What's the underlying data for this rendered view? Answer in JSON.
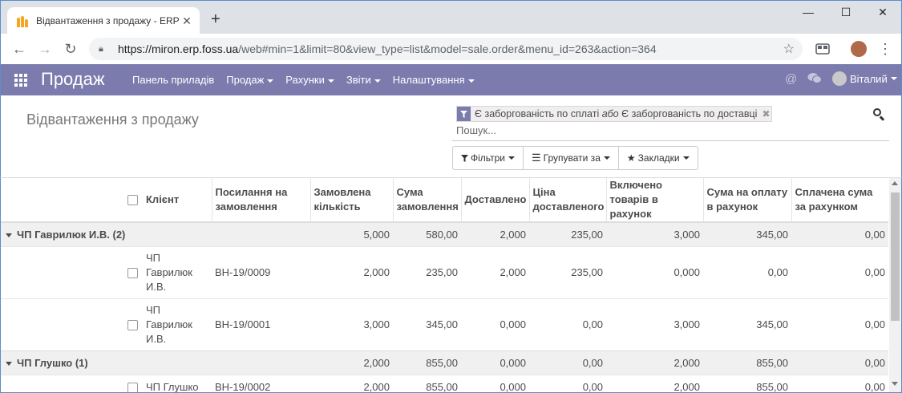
{
  "browser": {
    "tab_title": "Відвантаження з продажу - ERP",
    "tab_close": "✕",
    "new_tab": "+",
    "url_host": "https://miron.erp.foss.ua",
    "url_path": "/web#min=1&limit=80&view_type=list&model=sale.order&menu_id=263&action=364",
    "window_controls": {
      "minimize": "—",
      "maximize": "☐",
      "close": "✕"
    }
  },
  "navbar": {
    "brand": "Продаж",
    "menu": [
      "Панель приладів",
      "Продаж",
      "Рахунки",
      "Звіти",
      "Налаштування"
    ],
    "user_name": "Віталий",
    "color": "#7c7bad"
  },
  "control_panel": {
    "breadcrumb": "Відвантаження з продажу",
    "facet": {
      "part1": "Є заборгованість по сплаті",
      "connector": "або",
      "part2": "Є заборгованість по доставці"
    },
    "search_placeholder": "Пошук...",
    "buttons": {
      "filters": "Фільтри",
      "group_by": "Групувати за",
      "favorites": "Закладки"
    }
  },
  "table": {
    "headers": {
      "client": "Клієнт",
      "order_ref": "Посилання на замовлення",
      "ordered_qty": "Замовлена кількість",
      "order_amount": "Сума замовлення",
      "delivered": "Доставлено",
      "delivered_price": "Ціна доставленого",
      "invoiced_goods": "Включено товарів в рахунок",
      "to_invoice": "Сума на оплату в рахунок",
      "paid_amount": "Сплачена сума за рахунком"
    },
    "groups": [
      {
        "label": "ЧП Гаврилюк И.В. (2)",
        "ordered_qty": "5,000",
        "order_amount": "580,00",
        "delivered": "2,000",
        "delivered_price": "235,00",
        "invoiced_goods": "3,000",
        "to_invoice": "345,00",
        "paid_amount": "0,00",
        "rows": [
          {
            "client": "ЧП Гаврилюк И.В.",
            "ref": "ВН-19/0009",
            "ordered_qty": "2,000",
            "order_amount": "235,00",
            "delivered": "2,000",
            "delivered_price": "235,00",
            "invoiced_goods": "0,000",
            "to_invoice": "0,00",
            "paid_amount": "0,00"
          },
          {
            "client": "ЧП Гаврилюк И.В.",
            "ref": "ВН-19/0001",
            "ordered_qty": "3,000",
            "order_amount": "345,00",
            "delivered": "0,000",
            "delivered_price": "0,00",
            "invoiced_goods": "3,000",
            "to_invoice": "345,00",
            "paid_amount": "0,00"
          }
        ]
      },
      {
        "label": "ЧП Глушко (1)",
        "ordered_qty": "2,000",
        "order_amount": "855,00",
        "delivered": "0,000",
        "delivered_price": "0,00",
        "invoiced_goods": "2,000",
        "to_invoice": "855,00",
        "paid_amount": "0,00",
        "rows": [
          {
            "client": "ЧП Глушко",
            "ref": "ВН-19/0002",
            "ordered_qty": "2,000",
            "order_amount": "855,00",
            "delivered": "0,000",
            "delivered_price": "0,00",
            "invoiced_goods": "2,000",
            "to_invoice": "855,00",
            "paid_amount": "0,00"
          }
        ]
      }
    ]
  }
}
